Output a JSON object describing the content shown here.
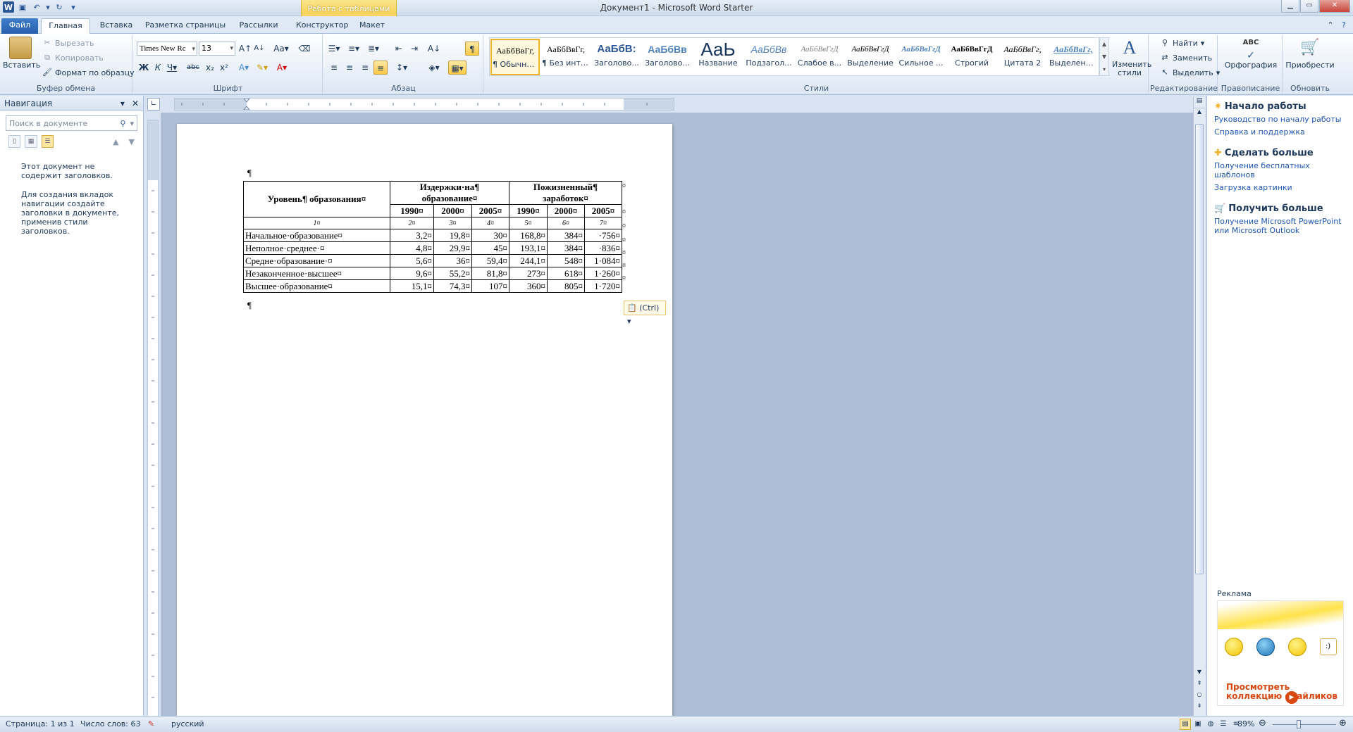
{
  "window": {
    "title": "Документ1 - Microsoft Word Starter",
    "context_tab_group": "Работа с таблицами"
  },
  "tabs": [
    {
      "label": "Файл"
    },
    {
      "label": "Главная",
      "active": true
    },
    {
      "label": "Вставка"
    },
    {
      "label": "Разметка страницы"
    },
    {
      "label": "Рассылки"
    },
    {
      "label": "Конструктор"
    },
    {
      "label": "Макет"
    }
  ],
  "ribbon": {
    "clipboard": {
      "label": "Буфер обмена",
      "paste": "Вставить",
      "cut": "Вырезать",
      "copy": "Копировать",
      "format_painter": "Формат по образцу"
    },
    "font": {
      "label": "Шрифт",
      "name": "Times New Rc",
      "size": "13"
    },
    "paragraph": {
      "label": "Абзац"
    },
    "styles": {
      "label": "Стили",
      "items": [
        {
          "preview": "АаБбВвГг,",
          "name": "¶ Обычный",
          "selected": true
        },
        {
          "preview": "АаБбВвГг,",
          "name": "¶ Без инте..."
        },
        {
          "preview": "АаБбВ:",
          "name": "Заголово..."
        },
        {
          "preview": "АаБбВв",
          "name": "Заголово..."
        },
        {
          "preview": "АаЬ",
          "name": "Название"
        },
        {
          "preview": "АаБбВв",
          "name": "Подзагол..."
        },
        {
          "preview": "АаБбВвГгД",
          "name": "Слабое в..."
        },
        {
          "preview": "АаБбВвГгД",
          "name": "Выделение"
        },
        {
          "preview": "АаБбВвГгД",
          "name": "Сильное ..."
        },
        {
          "preview": "АаБбВвГгД",
          "name": "Строгий"
        },
        {
          "preview": "АаБбВвГг,",
          "name": "Цитата 2"
        },
        {
          "preview": "АаБбВвГг,",
          "name": "Выделенн..."
        }
      ],
      "change_styles": "Изменить стили"
    },
    "editing": {
      "label": "Редактирование",
      "find": "Найти",
      "replace": "Заменить",
      "select": "Выделить"
    },
    "proofing": {
      "label": "Правописание",
      "spelling": "Орфография"
    },
    "upgrade": {
      "label": "Обновить",
      "buy": "Приобрести"
    }
  },
  "nav_pane": {
    "title": "Навигация",
    "search_placeholder": "Поиск в документе",
    "msg1": "Этот документ не содержит заголовков.",
    "msg2": "Для создания вкладок навигации создайте заголовки в документе, применив стили заголовков."
  },
  "table": {
    "h_level": "Уровень¶ образования¤",
    "h_costs": "Издержки·на¶ образование¤",
    "h_earnings": "Пожизненный¶ заработок¤",
    "years": [
      "1990¤",
      "2000¤",
      "2005¤",
      "1990¤",
      "2000¤",
      "2005¤"
    ],
    "colnums": [
      "1¤",
      "2¤",
      "3¤",
      "4¤",
      "5¤",
      "6¤",
      "7¤"
    ],
    "rows": [
      [
        "Начальное·образование¤",
        "3,2¤",
        "19,8¤",
        "30¤",
        "168,8¤",
        "384¤",
        "·756¤"
      ],
      [
        "Неполное·среднее·¤",
        "4,8¤",
        "29,9¤",
        "45¤",
        "193,1¤",
        "384¤",
        "·836¤"
      ],
      [
        "Средне·образование·¤",
        "5,6¤",
        "36¤",
        "59,4¤",
        "244,1¤",
        "548¤",
        "1·084¤"
      ],
      [
        "Незаконченное·высшее¤",
        "9,6¤",
        "55,2¤",
        "81,8¤",
        "273¤",
        "618¤",
        "1·260¤"
      ],
      [
        "Высшее·образование¤",
        "15,1¤",
        "74,3¤",
        "107¤",
        "360¤",
        "805¤",
        "1·720¤"
      ]
    ],
    "end_cell": "¤",
    "pilcrow": "¶",
    "paste_options": "(Ctrl)"
  },
  "side_panel": {
    "start_title": "Начало работы",
    "start_links": [
      "Руководство по началу работы",
      "Справка и поддержка"
    ],
    "more_title": "Сделать больше",
    "more_links": [
      "Получение бесплатных шаблонов",
      "Загрузка картинки"
    ],
    "get_title": "Получить больше",
    "get_links": [
      "Получение Microsoft PowerPoint или Microsoft Outlook"
    ],
    "ad_label": "Реклама",
    "ad_link": "Просмотреть коллекцию смайликов"
  },
  "status": {
    "page": "Страница: 1 из 1",
    "words": "Число слов: 63",
    "lang": "русский",
    "zoom": "89%"
  }
}
